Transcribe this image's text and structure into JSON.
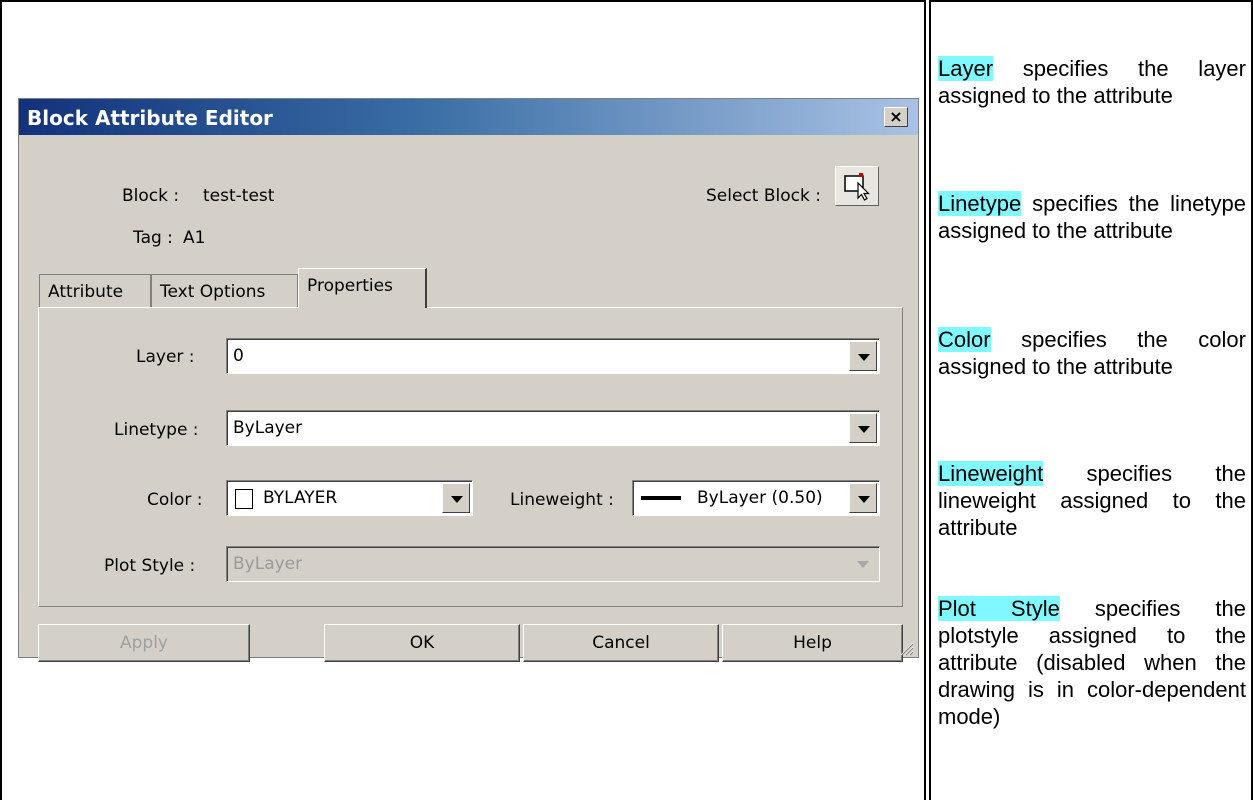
{
  "dialog": {
    "title": "Block Attribute Editor",
    "close_label": "×",
    "block_label": "Block :",
    "block_value": "test-test",
    "tag_label": "Tag :",
    "tag_value": "A1",
    "select_block_label": "Select Block :",
    "select_block_icon": "select-objects-icon"
  },
  "tabs": [
    {
      "label": "Attribute",
      "active": false
    },
    {
      "label": "Text Options",
      "active": false
    },
    {
      "label": "Properties",
      "active": true
    }
  ],
  "properties": {
    "layer_label": "Layer :",
    "layer_value": "0",
    "linetype_label": "Linetype :",
    "linetype_value": "ByLayer",
    "color_label": "Color :",
    "color_value": "BYLAYER",
    "lineweight_label": "Lineweight :",
    "lineweight_value": "ByLayer (0.50)",
    "plotstyle_label": "Plot Style :",
    "plotstyle_value": "ByLayer"
  },
  "buttons": {
    "apply": "Apply",
    "ok": "OK",
    "cancel": "Cancel",
    "help": "Help"
  },
  "descriptions": [
    {
      "term": "Layer",
      "text": " specifies the layer assigned to the attribute"
    },
    {
      "term": "Linetype",
      "text": " specifies the linetype assigned to the attribute"
    },
    {
      "term": "Color",
      "text": " specifies the color assigned to the attribute"
    },
    {
      "term": "Lineweight",
      "text": " specifies the lineweight assigned to the attribute"
    },
    {
      "term": "Plot Style",
      "text": " specifies the plotstyle assigned to the attribute (disabled when the drawing is in color-dependent mode)"
    }
  ],
  "colors": {
    "highlight": "#7ff8ff",
    "dialog_bg": "#d4d0c8",
    "title_gradient_start": "#12327c"
  }
}
